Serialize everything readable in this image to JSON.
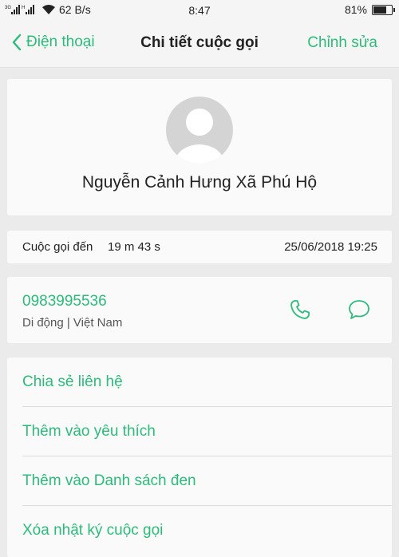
{
  "status_bar": {
    "network_speed": "62 B/s",
    "time": "8:47",
    "battery_percent": "81%",
    "battery_level": 0.81
  },
  "nav": {
    "back_label": "Điện thoại",
    "title": "Chi tiết cuộc gọi",
    "edit_label": "Chỉnh sửa"
  },
  "contact": {
    "name": "Nguyễn Cảnh Hưng Xã Phú Hộ"
  },
  "call": {
    "type": "Cuộc gọi đến",
    "duration": "19 m 43 s",
    "datetime": "25/06/2018 19:25"
  },
  "number": {
    "value": "0983995536",
    "label": "Di động | Việt Nam"
  },
  "actions": [
    {
      "label": "Chia sẻ liên hệ"
    },
    {
      "label": "Thêm vào yêu thích"
    },
    {
      "label": "Thêm vào Danh sách đen"
    },
    {
      "label": "Xóa nhật ký cuộc gọi"
    }
  ],
  "colors": {
    "accent": "#2dbb7c",
    "background": "#ebebeb",
    "card": "#fafafa"
  },
  "icons": {
    "call": "phone-icon",
    "message": "message-bubble-icon",
    "back": "chevron-left-icon"
  }
}
